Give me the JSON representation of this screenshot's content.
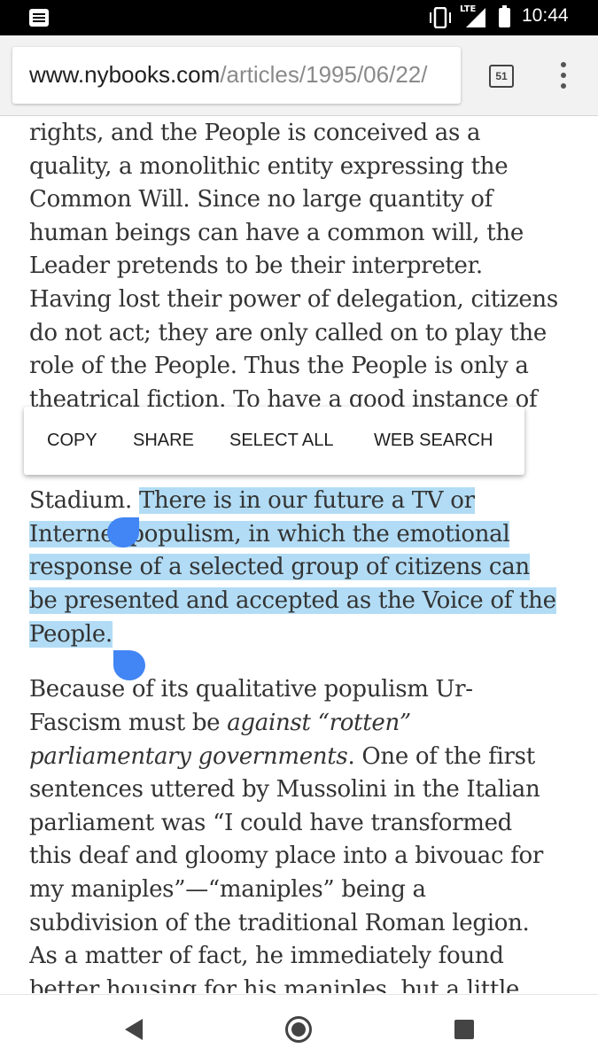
{
  "status_bar": {
    "network": "LTE",
    "time": "10:44"
  },
  "browser": {
    "url_domain": "www.nybooks.com",
    "url_path": "/articles/1995/06/22/",
    "tab_count": "51"
  },
  "article": {
    "lines": [
      "rights, and the People is conceived as a",
      "quality, a monolithic entity expressing the",
      "Common Will. Since no large quantity of",
      "human beings can have a common will, the",
      "Leader pretends to be their interpreter.",
      "Having lost their power of delegation, citizens",
      "do not act; they are only called on to play the",
      "role of the People. Thus the People is only a",
      "theatrical fiction. To have a good instance of"
    ],
    "stadium_plain": "Stadium. ",
    "selected_lines": [
      "There is in our future a TV or",
      "Internet populism, in which the emotional",
      "response of a selected group of citizens can",
      "be presented and accepted as the Voice of the",
      "People."
    ],
    "p2": {
      "l1": "Because of its qualitative populism Ur-",
      "l2_a": "Fascism must be ",
      "l2_b": "against “rotten”",
      "l3_a": "parliamentary governments",
      "l3_b": ". One of the first",
      "l4": "sentences uttered by Mussolini in the Italian",
      "l5": "parliament was “I could have transformed",
      "l6": "this deaf and gloomy place into a bivouac for",
      "l7": "my maniples”—“maniples” being a",
      "l8": "subdivision of the traditional Roman legion.",
      "l9": "As a matter of fact, he immediately found",
      "l10": "better housing for his maniples, but a little"
    }
  },
  "context_menu": {
    "copy": "COPY",
    "share": "SHARE",
    "select_all": "SELECT ALL",
    "web_search": "WEB SEARCH"
  },
  "colors": {
    "selection": "#b2dcf5",
    "handle": "#4285f4"
  }
}
